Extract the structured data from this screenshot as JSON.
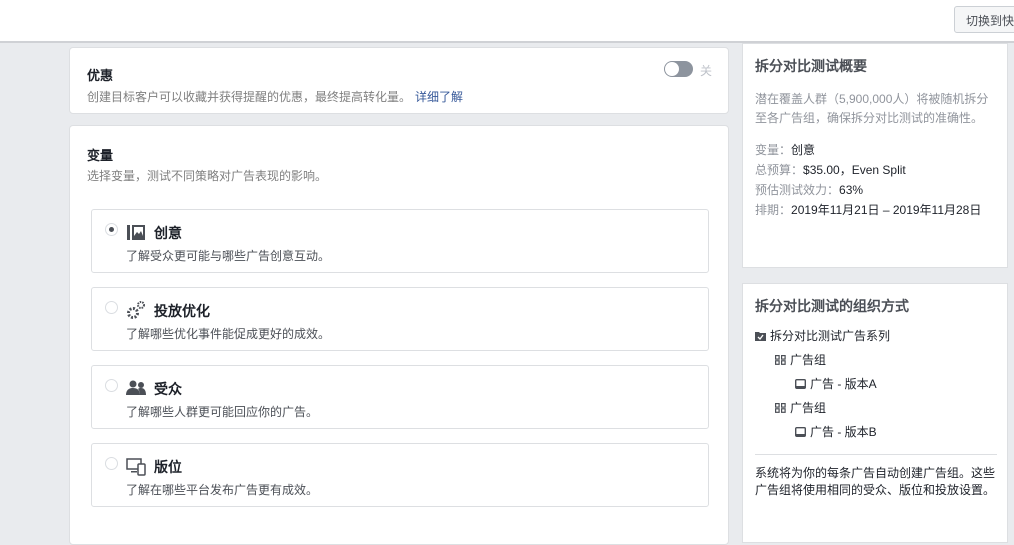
{
  "topbar": {
    "switch_button": "切换到快"
  },
  "offer": {
    "title": "优惠",
    "description": "创建目标客户可以收藏并获得提醒的优惠，最终提高转化量。",
    "learn_more": "详细了解",
    "toggle_state": "off",
    "toggle_label": "关"
  },
  "variable": {
    "title": "变量",
    "description": "选择变量，测试不同策略对广告表现的影响。",
    "options": [
      {
        "icon": "image-icon",
        "label": "创意",
        "description": "了解受众更可能与哪些广告创意互动。",
        "selected": true
      },
      {
        "icon": "gears-icon",
        "label": "投放优化",
        "description": "了解哪些优化事件能促成更好的成效。",
        "selected": false
      },
      {
        "icon": "people-icon",
        "label": "受众",
        "description": "了解哪些人群更可能回应你的广告。",
        "selected": false
      },
      {
        "icon": "devices-icon",
        "label": "版位",
        "description": "了解在哪些平台发布广告更有成效。",
        "selected": false
      }
    ]
  },
  "summary": {
    "title": "拆分对比测试概要",
    "description": "潜在覆盖人群（5,900,000人）将被随机拆分至各广告组，确保拆分对比测试的准确性。",
    "variable_label": "变量：",
    "variable_value": "创意",
    "budget_label": "总预算：",
    "budget_value": "$35.00，Even Split",
    "power_label": "预估测试效力：",
    "power_value": "63%",
    "schedule_label": "排期：",
    "schedule_value": "2019年11月21日 – 2019年11月28日"
  },
  "structure": {
    "title": "拆分对比测试的组织方式",
    "campaign": "拆分对比测试广告系列",
    "adset1": "广告组",
    "ad1": "广告 - 版本A",
    "adset2": "广告组",
    "ad2": "广告 - 版本B",
    "note": "系统将为你的每条广告自动创建广告组。这些广告组将使用相同的受众、版位和投放设置。"
  }
}
